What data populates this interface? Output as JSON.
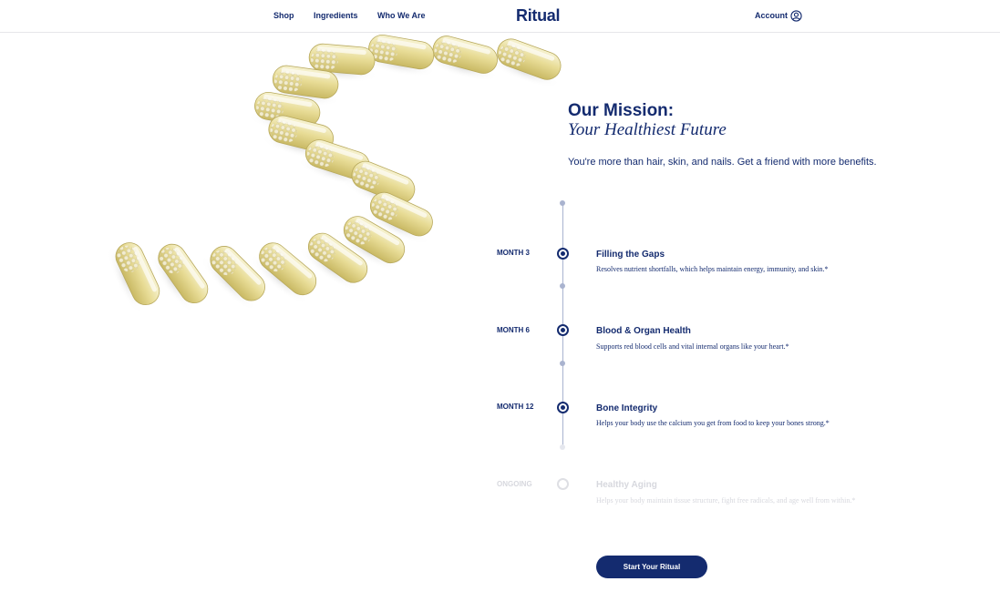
{
  "header": {
    "nav": [
      "Shop",
      "Ingredients",
      "Who We Are"
    ],
    "logo": "Ritual",
    "account_label": "Account"
  },
  "mission": {
    "title": "Our Mission:",
    "subtitle": "Your Healthiest Future",
    "description": "You're more than hair, skin, and nails. Get a friend with more benefits."
  },
  "timeline": [
    {
      "month": "MONTH 3",
      "title": "Filling the Gaps",
      "desc": "Resolves nutrient shortfalls, which helps maintain energy, immunity, and skin.*"
    },
    {
      "month": "MONTH 6",
      "title": "Blood & Organ Health",
      "desc": "Supports red blood cells and vital internal organs like your heart.*"
    },
    {
      "month": "MONTH 12",
      "title": "Bone Integrity",
      "desc": "Helps your body use the calcium you get from food to keep your bones strong.*"
    },
    {
      "month": "ONGOING",
      "title": "Healthy Aging",
      "desc": "Helps your body maintain tissue structure, fight free radicals, and age well from within.*"
    }
  ],
  "cta_label": "Start Your Ritual",
  "colors": {
    "brand": "#142b6f",
    "timeline": "#a9b3cf",
    "faded": "#d7d8de"
  },
  "icons": {
    "account": "user-circle-icon"
  }
}
